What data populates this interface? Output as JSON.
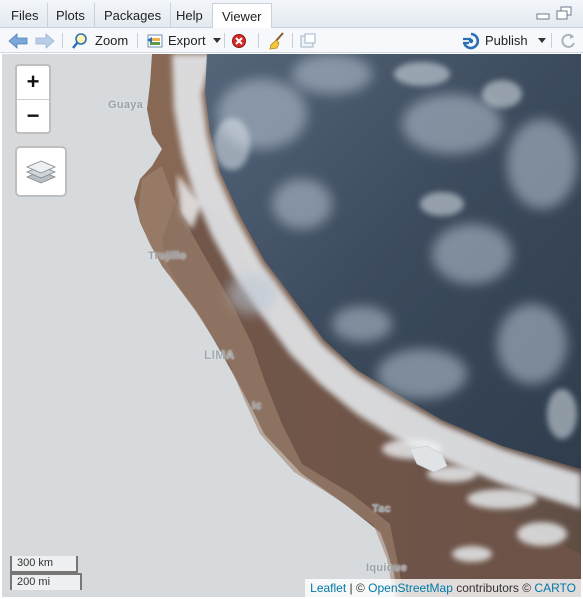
{
  "tabs": [
    {
      "label": "Files"
    },
    {
      "label": "Plots"
    },
    {
      "label": "Packages"
    },
    {
      "label": "Help"
    },
    {
      "label": "Viewer"
    }
  ],
  "toolbar": {
    "zoom_label": "Zoom",
    "export_label": "Export",
    "publish_label": "Publish"
  },
  "map": {
    "zoom_in": "+",
    "zoom_out": "−",
    "cities": {
      "guayaquil": "Guaya",
      "trujillo": "Trujillo",
      "lima": "LIMA",
      "ica": "Ic",
      "tacna": "Tac",
      "iquique": "Iquique"
    },
    "scale_km": "300 km",
    "scale_mi": "200 mi",
    "attribution": {
      "leaflet": "Leaflet",
      "sep": " | © ",
      "osm": "OpenStreetMap",
      "contributors": " contributors © ",
      "carto": "CARTO"
    }
  },
  "icons": [
    "back-arrow-icon",
    "forward-arrow-icon",
    "zoom-magnifier-icon",
    "export-icon",
    "clear-icon",
    "broom-icon",
    "popout-icon",
    "publish-icon",
    "refresh-icon",
    "minimize-icon",
    "maximize-icon",
    "layers-icon"
  ],
  "colors": {
    "accent": "#2a6fb5",
    "ocean": "#d7dadd",
    "cloud": "#4a5b6e"
  }
}
